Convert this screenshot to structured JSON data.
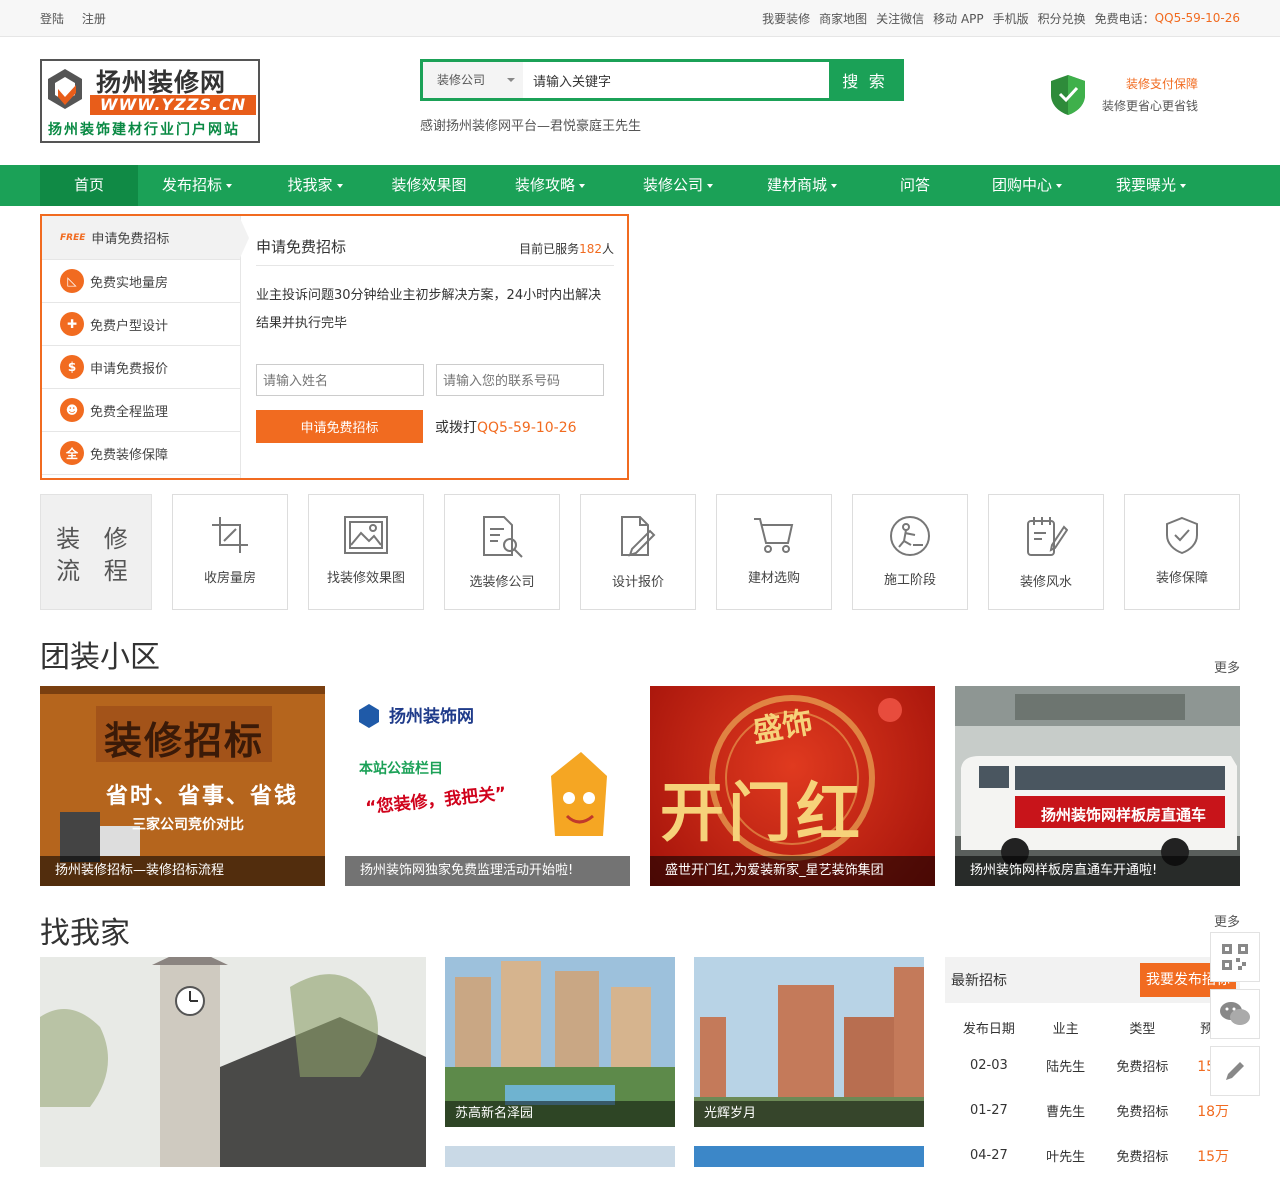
{
  "topbar": {
    "login": "登陆",
    "register": "注册",
    "links": [
      "我要装修",
      "商家地图",
      "关注微信",
      "移动 APP",
      "手机版",
      "积分兑换"
    ],
    "phone_label": "免费电话：",
    "phone": "QQ5-59-10-26"
  },
  "logo": {
    "title": "扬州装修网",
    "url": "WWW.YZZS.CN",
    "subtitle": "扬州装饰建材行业门户网站"
  },
  "search": {
    "category": "装修公司",
    "value": "请输入关键字",
    "button": "搜 索",
    "slogan": "感谢扬州装修网平台—君悦豪庭王先生"
  },
  "guarantee": {
    "line1": "装修支付保障",
    "line2": "装修更省心更省钱"
  },
  "nav": [
    {
      "label": "首页",
      "caret": false
    },
    {
      "label": "发布招标",
      "caret": true
    },
    {
      "label": "找我家",
      "caret": true
    },
    {
      "label": "装修效果图",
      "caret": false
    },
    {
      "label": "装修攻略",
      "caret": true
    },
    {
      "label": "装修公司",
      "caret": true
    },
    {
      "label": "建材商城",
      "caret": true
    },
    {
      "label": "问答",
      "caret": false
    },
    {
      "label": "团购中心",
      "caret": true
    },
    {
      "label": "我要曝光",
      "caret": true
    }
  ],
  "tender": {
    "free_badge": "FREE",
    "menu": [
      "申请免费招标",
      "免费实地量房",
      "免费户型设计",
      "申请免费报价",
      "免费全程监理",
      "免费装修保障"
    ],
    "form_title": "申请免费招标",
    "served_prefix": "目前已服务",
    "served_count": "182",
    "served_suffix": "人",
    "desc": "业主投诉问题30分钟给业主初步解决方案，24小时内出解决结果并执行完毕",
    "name_placeholder": "请输入姓名",
    "phone_placeholder": "请输入您的联系号码",
    "submit": "申请免费招标",
    "or_call": "或拨打",
    "call_number": "QQ5-59-10-26"
  },
  "process": {
    "title": "装 修 流 程",
    "steps": [
      "收房量房",
      "找装修效果图",
      "选装修公司",
      "设计报价",
      "建材选购",
      "施工阶段",
      "装修风水",
      "装修保障"
    ]
  },
  "group": {
    "title": "团装小区",
    "more": "更多",
    "items": [
      {
        "caption": "扬州装修招标—装修招标流程",
        "img_text": "装修招标",
        "img_sub": "省时、省事、省钱",
        "img_sub2": "三家公司竞价对比"
      },
      {
        "caption": "扬州装饰网独家免费监理活动开始啦!",
        "img_text": "扬州装饰网",
        "img_sub": "本站公益栏目",
        "img_sub2": "“您装修，我把关”"
      },
      {
        "caption": "盛世开门红,为爱装新家_星艺装饰集团",
        "img_text": "开门红",
        "img_sub": "盛饰"
      },
      {
        "caption": "扬州装饰网样板房直通车开通啦!",
        "img_text": "扬州装饰网样板房直通车"
      }
    ]
  },
  "findhome": {
    "title": "找我家",
    "more": "更多",
    "items": [
      "苏高新名泽园",
      "光辉岁月"
    ]
  },
  "latest": {
    "title": "最新招标",
    "button": "我要发布招标",
    "columns": [
      "发布日期",
      "业主",
      "类型",
      "预算"
    ],
    "rows": [
      [
        "02-03",
        "陆先生",
        "免费招标",
        "15万"
      ],
      [
        "01-27",
        "曹先生",
        "免费招标",
        "18万"
      ],
      [
        "04-27",
        "叶先生",
        "免费招标",
        "15万"
      ]
    ]
  },
  "colors": {
    "brand_green": "#1ba157",
    "accent_orange": "#f16b20"
  }
}
